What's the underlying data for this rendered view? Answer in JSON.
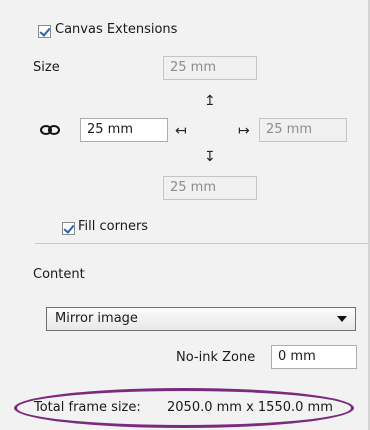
{
  "canvas_extensions": {
    "label": "Canvas Extensions",
    "checked": true
  },
  "size": {
    "label": "Size",
    "top": "25 mm",
    "left": "25 mm",
    "right": "25 mm",
    "bottom": "25 mm",
    "link_icon": "chain-link-icon"
  },
  "arrows": {
    "up": "↥",
    "left": "↤",
    "right": "↦",
    "down": "↧"
  },
  "fill_corners": {
    "label": "Fill corners",
    "checked": true
  },
  "content": {
    "label": "Content",
    "selected": "Mirror image"
  },
  "no_ink_zone": {
    "label": "No-ink Zone",
    "value": "0 mm"
  },
  "total_frame": {
    "label": "Total frame size:",
    "value": "2050.0 mm x 1550.0 mm"
  },
  "colors": {
    "accent_oval": "#7a2b7e",
    "check": "#2a5fb0"
  }
}
